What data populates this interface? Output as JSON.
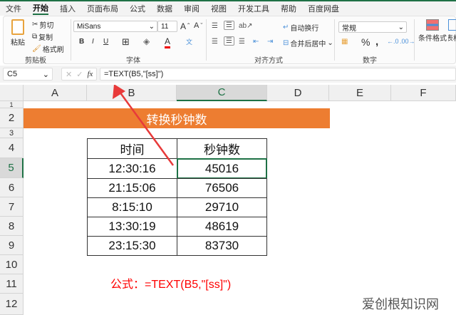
{
  "ribbon_tabs": [
    "文件",
    "开始",
    "插入",
    "页面布局",
    "公式",
    "数据",
    "审阅",
    "视图",
    "开发工具",
    "帮助",
    "百度网盘"
  ],
  "active_tab": "开始",
  "clipboard": {
    "paste": "粘贴",
    "cut": "剪切",
    "copy": "复制",
    "format_painter": "格式刷",
    "label": "剪贴板"
  },
  "font": {
    "name": "MiSans",
    "size": "11",
    "bold": "B",
    "italic": "I",
    "underline": "U",
    "label": "字体"
  },
  "alignment": {
    "wrap": "自动换行",
    "merge": "合并后居中",
    "label": "对齐方式"
  },
  "number": {
    "format": "常规",
    "percent": "%",
    "comma": ",",
    "label": "数字"
  },
  "styles": {
    "conditional": "条件格式",
    "table_format": "套用表格格式"
  },
  "formula_bar": {
    "name_box": "C5",
    "fx": "fx",
    "formula": "=TEXT(B5,\"[ss]\")"
  },
  "columns": [
    "A",
    "B",
    "C",
    "D",
    "E",
    "F"
  ],
  "rows": [
    "1",
    "2",
    "3",
    "4",
    "5",
    "6",
    "7",
    "8",
    "9",
    "10",
    "11",
    "12"
  ],
  "selected_cell": "C5",
  "sheet": {
    "title": "转换秒钟数",
    "headers": [
      "时间",
      "秒钟数"
    ],
    "data": [
      [
        "12:30:16",
        "45016"
      ],
      [
        "21:15:06",
        "76506"
      ],
      [
        "8:15:10",
        "29710"
      ],
      [
        "13:30:19",
        "48619"
      ],
      [
        "23:15:30",
        "83730"
      ]
    ],
    "note": "公式：=TEXT(B5,\"[ss]\")"
  },
  "watermark": "爱创根知识网",
  "colors": {
    "accent": "#1e7145",
    "title_fill": "#ed7d31",
    "note": "#ff0000",
    "arrow": "#e83a3a"
  }
}
